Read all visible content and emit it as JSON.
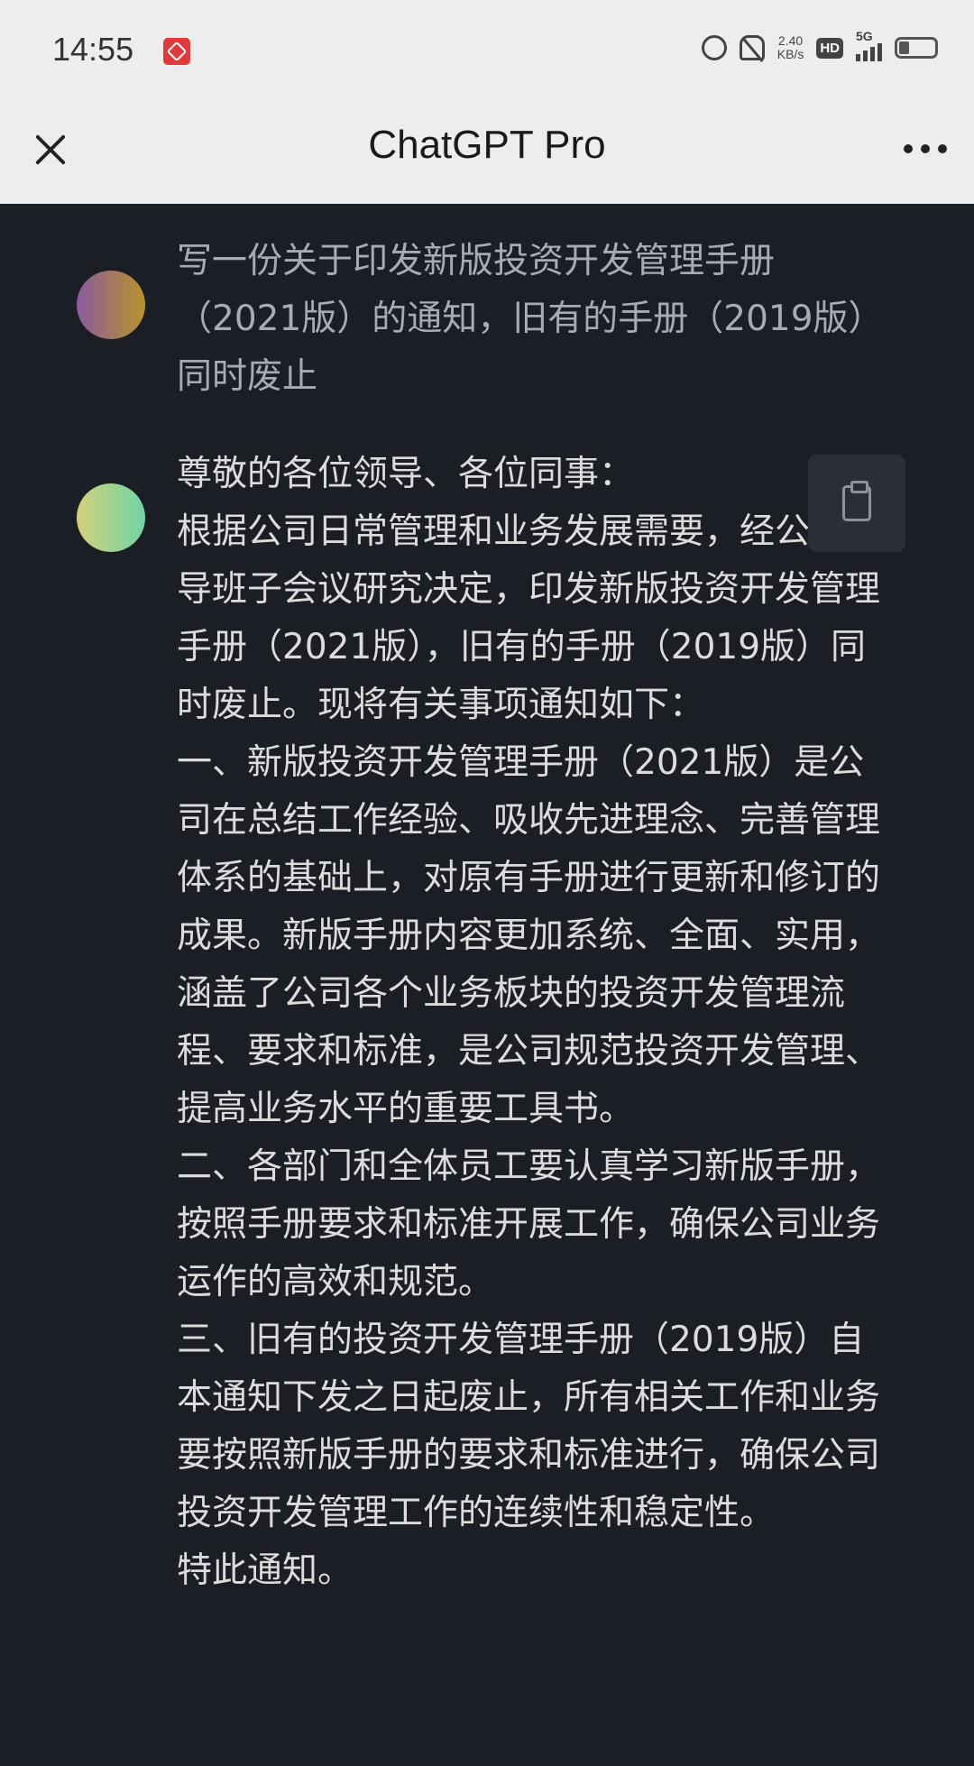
{
  "status_bar": {
    "time": "14:55",
    "net_speed_value": "2.40",
    "net_speed_unit": "KB/s",
    "hd_label": "HD",
    "signal_label": "5G",
    "icons": [
      "app-notification-icon",
      "alarm-icon",
      "mute-icon",
      "hd-icon",
      "signal-icon",
      "battery-icon"
    ]
  },
  "header": {
    "title": "ChatGPT Pro",
    "close_icon": "close-icon",
    "more_icon": "more-icon"
  },
  "conversation": {
    "user_message": "写一份关于印发新版投资开发管理手册（2021版）的通知，旧有的手册（2019版）同时废止",
    "bot_message": {
      "paragraphs": [
        "尊敬的各位领导、各位同事：",
        "根据公司日常管理和业务发展需要，经公司领导班子会议研究决定，印发新版投资开发管理手册（2021版），旧有的手册（2019版）同时废止。现将有关事项通知如下：",
        "一、新版投资开发管理手册（2021版）是公司在总结工作经验、吸收先进理念、完善管理体系的基础上，对原有手册进行更新和修订的成果。新版手册内容更加系统、全面、实用，涵盖了公司各个业务板块的投资开发管理流程、要求和标准，是公司规范投资开发管理、提高业务水平的重要工具书。",
        "二、各部门和全体员工要认真学习新版手册，按照手册要求和标准开展工作，确保公司业务运作的高效和规范。",
        "三、旧有的投资开发管理手册（2019版）自本通知下发之日起废止，所有相关工作和业务要按照新版手册的要求和标准进行，确保公司投资开发管理工作的连续性和稳定性。",
        "特此通知。"
      ]
    },
    "copy_icon": "clipboard-icon"
  }
}
